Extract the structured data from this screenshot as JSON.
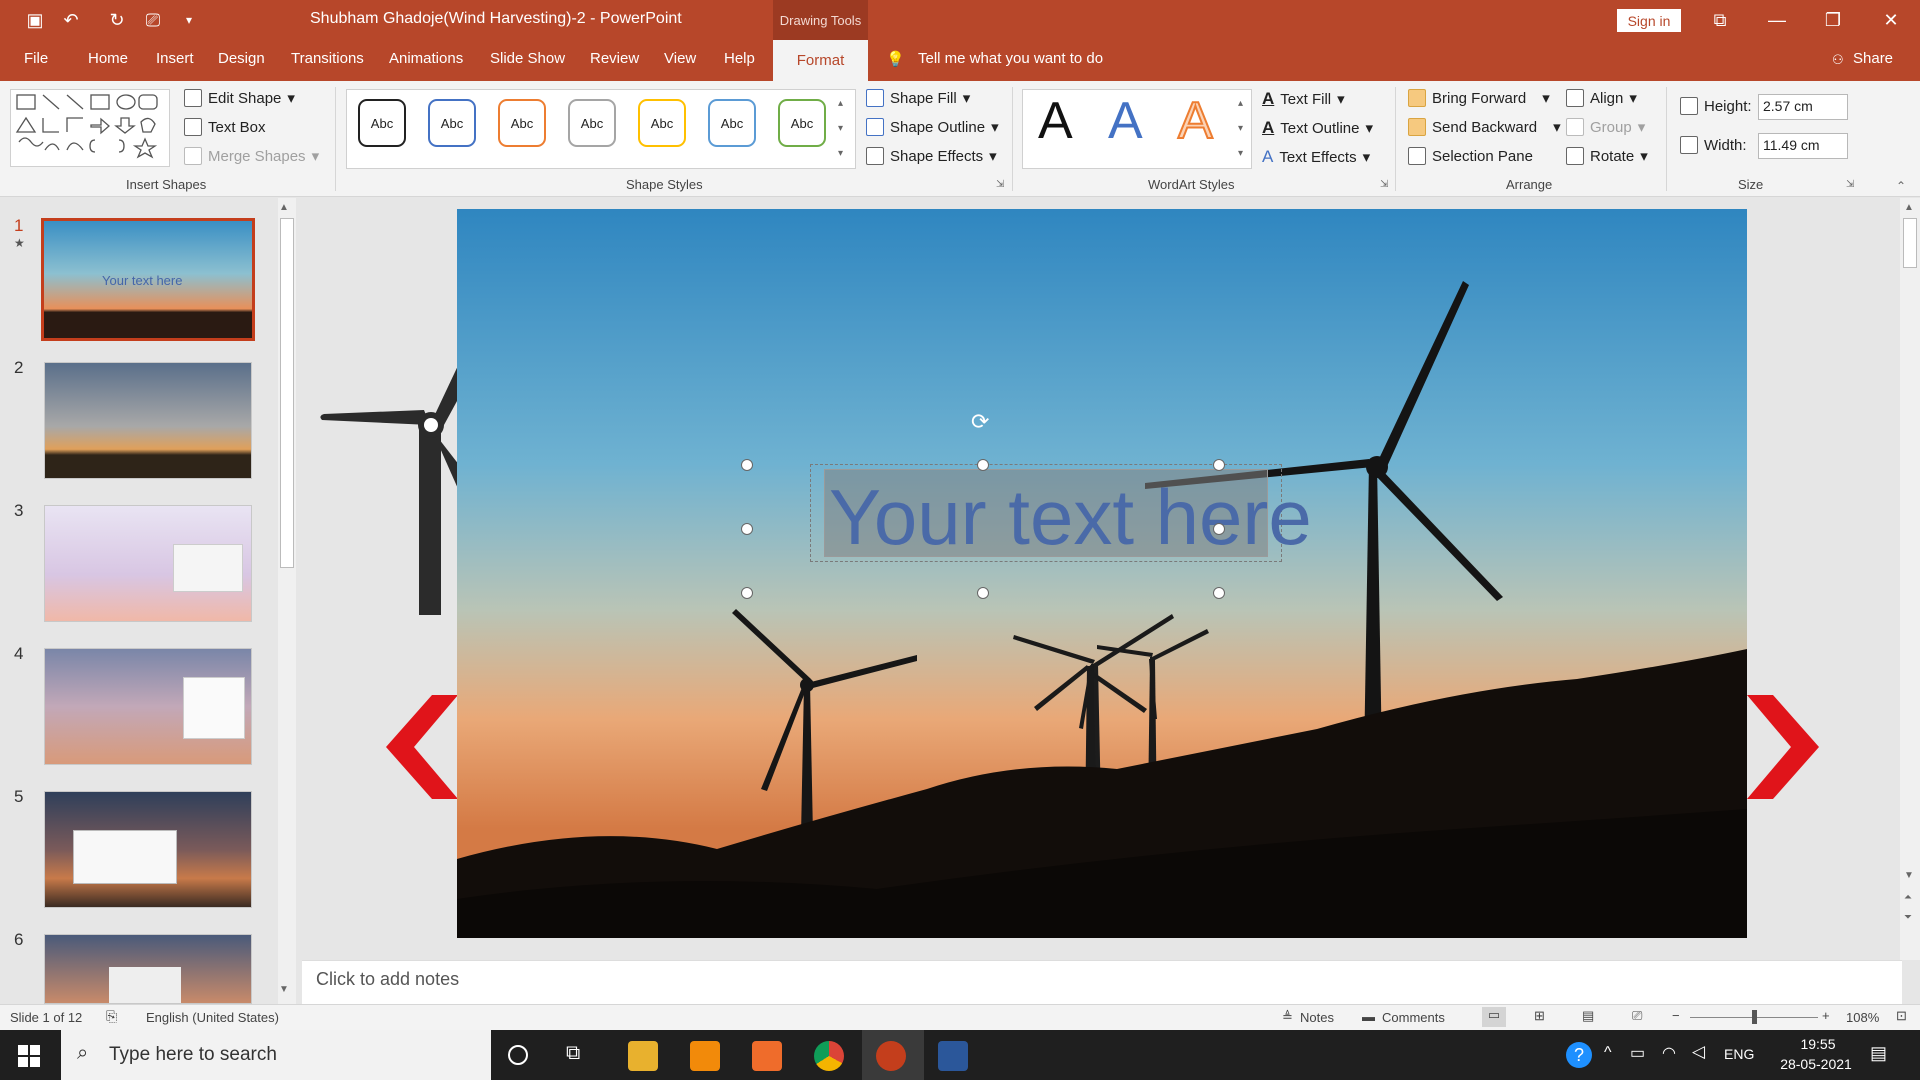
{
  "window": {
    "title": "Shubham Ghadoje(Wind Harvesting)-2  -  PowerPoint",
    "context_label": "Drawing Tools",
    "sign_in": "Sign in"
  },
  "tabs": [
    "File",
    "Home",
    "Insert",
    "Design",
    "Transitions",
    "Animations",
    "Slide Show",
    "Review",
    "View",
    "Help",
    "Format"
  ],
  "tell_me": "Tell me what you want to do",
  "share": "Share",
  "ribbon": {
    "insert_shapes": {
      "label": "Insert Shapes",
      "edit_shape": "Edit Shape",
      "text_box": "Text Box",
      "merge_shapes": "Merge Shapes"
    },
    "shape_styles": {
      "label": "Shape Styles",
      "preset": "Abc",
      "shape_fill": "Shape Fill",
      "shape_outline": "Shape Outline",
      "shape_effects": "Shape Effects",
      "preset_colors": [
        "#222222",
        "#4472c4",
        "#ed7d31",
        "#a5a5a5",
        "#ffc000",
        "#5b9bd5",
        "#70ad47"
      ]
    },
    "wordart_styles": {
      "label": "WordArt Styles",
      "glyph": "A",
      "text_fill": "Text Fill",
      "text_outline": "Text Outline",
      "text_effects": "Text Effects"
    },
    "arrange": {
      "label": "Arrange",
      "bring_forward": "Bring Forward",
      "send_backward": "Send Backward",
      "selection_pane": "Selection Pane",
      "align": "Align",
      "group": "Group",
      "rotate": "Rotate"
    },
    "size": {
      "label": "Size",
      "height_label": "Height:",
      "height_value": "2.57 cm",
      "width_label": "Width:",
      "width_value": "11.49 cm"
    }
  },
  "slides": [
    {
      "num": "1",
      "caption": "Your text here"
    },
    {
      "num": "2"
    },
    {
      "num": "3"
    },
    {
      "num": "4"
    },
    {
      "num": "5"
    },
    {
      "num": "6"
    }
  ],
  "slide": {
    "textbox": "Your text here"
  },
  "notes_placeholder": "Click to add notes",
  "status": {
    "slide": "Slide 1 of 12",
    "language": "English (United States)",
    "notes": "Notes",
    "comments": "Comments",
    "zoom": "108%"
  },
  "taskbar": {
    "search": "Type here to search",
    "time": "19:55",
    "date": "28-05-2021",
    "lang": "ENG"
  },
  "colors": {
    "accent": "#b7472a",
    "arrow": "#e0141a"
  }
}
